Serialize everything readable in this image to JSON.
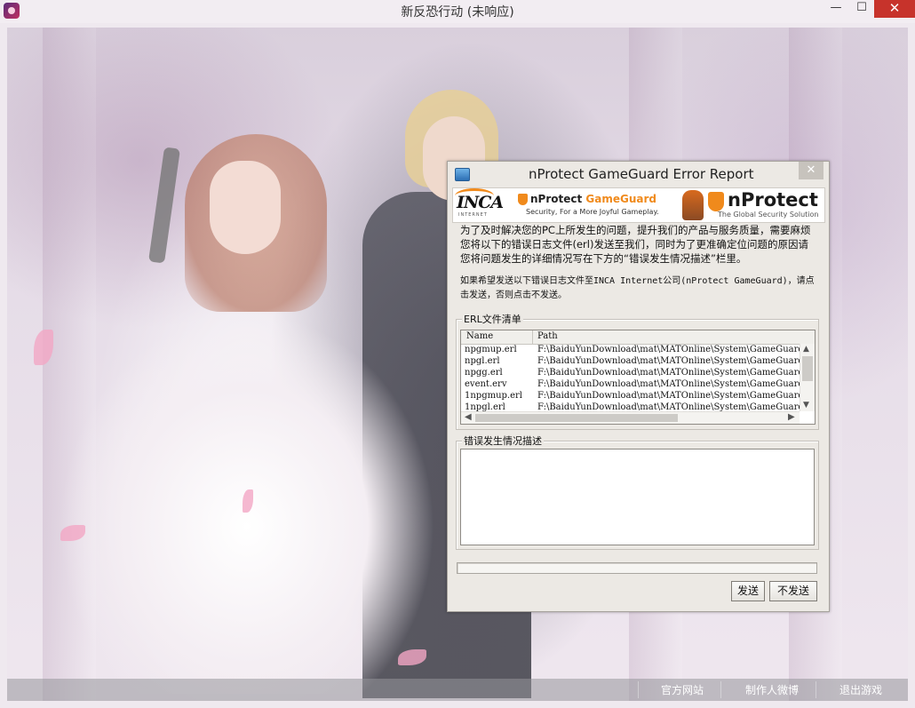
{
  "window": {
    "title": "新反恐行动 (未响应)",
    "minimize_glyph": "—",
    "maximize_glyph": "☐",
    "close_glyph": "✕"
  },
  "bottom_bar": {
    "links": [
      "官方网站",
      "制作人微博",
      "退出游戏"
    ]
  },
  "dialog": {
    "title": "nProtect GameGuard Error Report",
    "close_glyph": "✕",
    "banner": {
      "inca_logo": "INCA",
      "inca_sub": "INTERNET",
      "gameguard_name_prefix": "nProtect ",
      "gameguard_name_accent": "GameGuard",
      "gameguard_tagline": "Security, For a More Joyful Gameplay.",
      "nprotect_name": "nProtect",
      "nprotect_tagline": "The Global Security Solution"
    },
    "paragraph1": "为了及时解决您的PC上所发生的问题，提升我们的产品与服务质量，需要麻烦您将以下的错误日志文件(erl)发送至我们，同时为了更准确定位问题的原因请您将问题发生的详细情况写在下方的“错误发生情况描述”栏里。",
    "paragraph2": "如果希望发送以下错误日志文件至INCA Internet公司(nProtect GameGuard)，请点击发送，否则点击不发送。",
    "erl_group": {
      "label": "ERL文件清单",
      "columns": [
        "Name",
        "Path"
      ],
      "rows": [
        {
          "name": "npgmup.erl",
          "path": "F:\\BaiduYunDownload\\mat\\MATOnline\\System\\GameGuard"
        },
        {
          "name": "npgl.erl",
          "path": "F:\\BaiduYunDownload\\mat\\MATOnline\\System\\GameGuard"
        },
        {
          "name": "npgg.erl",
          "path": "F:\\BaiduYunDownload\\mat\\MATOnline\\System\\GameGuard"
        },
        {
          "name": "event.erv",
          "path": "F:\\BaiduYunDownload\\mat\\MATOnline\\System\\GameGuard"
        },
        {
          "name": "1npgmup.erl",
          "path": "F:\\BaiduYunDownload\\mat\\MATOnline\\System\\GameGuard"
        },
        {
          "name": "1npgl.erl",
          "path": "F:\\BaiduYunDownload\\mat\\MATOnline\\System\\GameGuard"
        }
      ]
    },
    "desc_group": {
      "label": "错误发生情况描述",
      "value": ""
    },
    "progress": 0,
    "buttons": {
      "send": "发送",
      "no_send": "不发送"
    }
  }
}
